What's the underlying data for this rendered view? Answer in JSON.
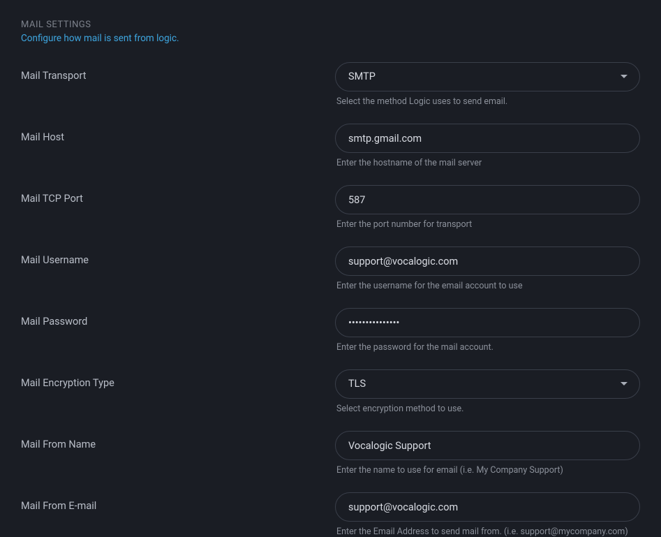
{
  "section": {
    "title": "MAIL SETTINGS",
    "subtitle": "Configure how mail is sent from logic."
  },
  "fields": {
    "transport": {
      "label": "Mail Transport",
      "value": "SMTP",
      "help": "Select the method Logic uses to send email."
    },
    "host": {
      "label": "Mail Host",
      "value": "smtp.gmail.com",
      "help": "Enter the hostname of the mail server"
    },
    "port": {
      "label": "Mail TCP Port",
      "value": "587",
      "help": "Enter the port number for transport"
    },
    "username": {
      "label": "Mail Username",
      "value": "support@vocalogic.com",
      "help": "Enter the username for the email account to use"
    },
    "password": {
      "label": "Mail Password",
      "value": "•••••••••••••••",
      "help": "Enter the password for the mail account."
    },
    "encryption": {
      "label": "Mail Encryption Type",
      "value": "TLS",
      "help": "Select encryption method to use."
    },
    "from_name": {
      "label": "Mail From Name",
      "value": "Vocalogic Support",
      "help": "Enter the name to use for email (i.e. My Company Support)"
    },
    "from_email": {
      "label": "Mail From E-mail",
      "value": "support@vocalogic.com",
      "help": "Enter the Email Address to send mail from. (i.e. support@mycompany.com)"
    }
  }
}
